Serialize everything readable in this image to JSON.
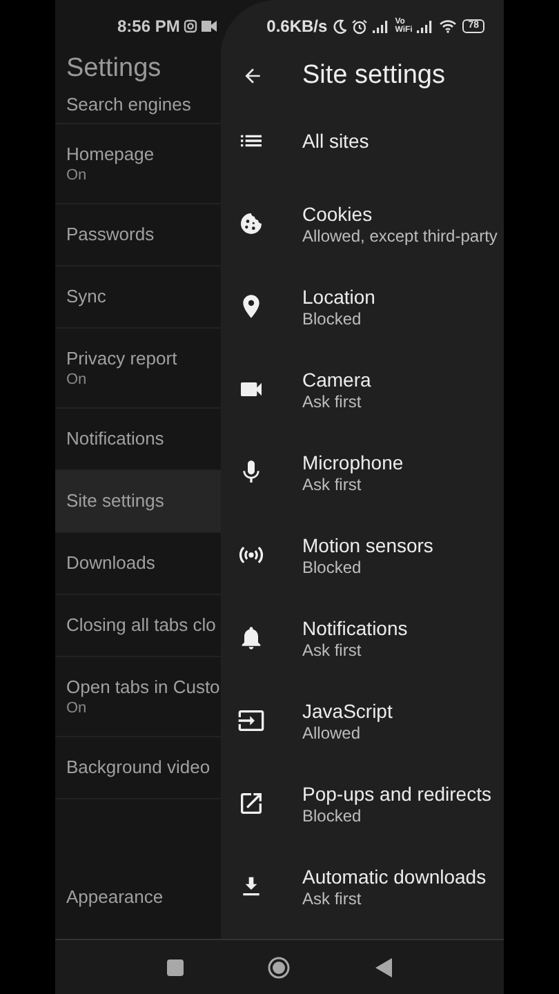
{
  "status_bar": {
    "time": "8:56 PM",
    "speed": "0.6KB/s",
    "vowifi": "Vo WiFi",
    "battery": "78"
  },
  "settings": {
    "title": "Settings",
    "items": [
      {
        "label": "Search engines",
        "selected": false
      },
      {
        "label": "Homepage",
        "sublabel": "On",
        "selected": false
      },
      {
        "label": "Passwords",
        "selected": false
      },
      {
        "label": "Sync",
        "selected": false
      },
      {
        "label": "Privacy report",
        "sublabel": "On",
        "selected": false
      },
      {
        "label": "Notifications",
        "selected": false
      },
      {
        "label": "Site settings",
        "selected": true
      },
      {
        "label": "Downloads",
        "selected": false
      },
      {
        "label": "Closing all tabs clo",
        "selected": false
      },
      {
        "label": "Open tabs in Custo",
        "sublabel": "On",
        "selected": false
      },
      {
        "label": "Background video",
        "selected": false
      },
      {
        "label": "Appearance",
        "selected": false
      }
    ]
  },
  "site_settings": {
    "title": "Site settings",
    "items": [
      {
        "kind": "list",
        "label": "All sites"
      },
      {
        "kind": "cookie",
        "label": "Cookies",
        "sublabel": "Allowed, except third-party"
      },
      {
        "kind": "location",
        "label": "Location",
        "sublabel": "Blocked"
      },
      {
        "kind": "camera",
        "label": "Camera",
        "sublabel": "Ask first"
      },
      {
        "kind": "microphone",
        "label": "Microphone",
        "sublabel": "Ask first"
      },
      {
        "kind": "sensors",
        "label": "Motion sensors",
        "sublabel": "Blocked"
      },
      {
        "kind": "bell",
        "label": "Notifications",
        "sublabel": "Ask first"
      },
      {
        "kind": "javascript",
        "label": "JavaScript",
        "sublabel": "Allowed"
      },
      {
        "kind": "popup",
        "label": "Pop-ups and redirects",
        "sublabel": "Blocked"
      },
      {
        "kind": "download",
        "label": "Automatic downloads",
        "sublabel": "Ask first"
      }
    ]
  }
}
